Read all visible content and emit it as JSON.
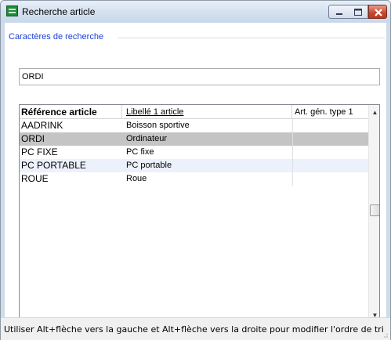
{
  "window": {
    "title": "Recherche article",
    "icon": "app-icon"
  },
  "search": {
    "group_label": "Caractères de recherche",
    "value": "ORDI"
  },
  "grid": {
    "columns": [
      "Référence article",
      "Libellé 1 article",
      "Art. gén. type 1"
    ],
    "rows": [
      {
        "ref": "AADRINK",
        "label": "Boisson sportive",
        "type": ""
      },
      {
        "ref": "ORDI",
        "label": "Ordinateur",
        "type": "",
        "selected": true
      },
      {
        "ref": "PC FIXE",
        "label": "PC fixe",
        "type": ""
      },
      {
        "ref": "PC PORTABLE",
        "label": "PC portable",
        "type": ""
      },
      {
        "ref": "ROUE",
        "label": "Roue",
        "type": ""
      }
    ]
  },
  "status": {
    "text": "Utiliser Alt+flèche vers la gauche et Alt+flèche vers la droite pour modifier l'ordre de tri"
  },
  "colors": {
    "group_label": "#1a3fd6",
    "selected_row": "#c4c4c4",
    "alt_row": "#ecf1fb",
    "close_button": "#c8452c"
  }
}
